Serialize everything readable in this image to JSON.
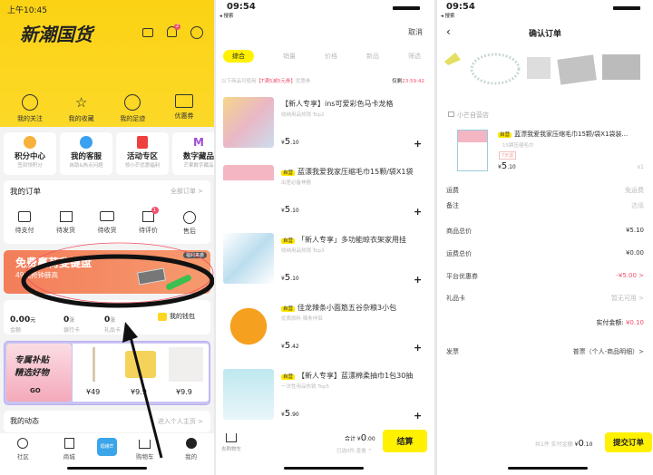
{
  "screen1": {
    "status_time": "上午10:45",
    "logo_text": "新潮国货",
    "notification_badge": "2",
    "quick_links": [
      {
        "label": "我的关注",
        "icon": "heart-icon"
      },
      {
        "label": "我的收藏",
        "icon": "star-icon"
      },
      {
        "label": "我的足迹",
        "icon": "clock-icon"
      },
      {
        "label": "优惠券",
        "icon": "ticket-icon"
      }
    ],
    "service_cards": [
      {
        "title": "积分中心",
        "sub": "签到领积分"
      },
      {
        "title": "我的客服",
        "sub": "自助&热点问题"
      },
      {
        "title": "活动专区",
        "sub": "领小芒优惠福利"
      },
      {
        "title": "数字藏品",
        "sub": "芒果数字藏品"
      }
    ],
    "orders": {
      "title": "我的订单",
      "all": "全部订单 >",
      "items": [
        {
          "label": "待支付"
        },
        {
          "label": "待发货"
        },
        {
          "label": "待收货"
        },
        {
          "label": "待评价",
          "badge": "1"
        },
        {
          "label": "售后"
        }
      ]
    },
    "banner": {
      "title": "免费赢荷斐键盘",
      "sub": "49元抢钟薛高",
      "corner": "福利来袭"
    },
    "wallet": {
      "amount": "0.00",
      "amount_unit": "元",
      "amount_label": "金额",
      "bank_count": "0",
      "bank_unit": "张",
      "bank_label": "银行卡",
      "gift_count": "0",
      "gift_unit": "张",
      "gift_label": "礼品卡",
      "wallet_label": "我的钱包"
    },
    "promo": {
      "title1": "专属补贴",
      "title2": "精选好物",
      "go": "GO",
      "prices": [
        "¥49",
        "¥9.9",
        "¥9.9"
      ]
    },
    "dynamics": {
      "title": "我的动态",
      "link": "进入个人主页 >"
    },
    "tabbar": [
      {
        "label": "社区"
      },
      {
        "label": "商城"
      },
      {
        "label": "逛綫芒"
      },
      {
        "label": "购物车"
      },
      {
        "label": "我的"
      }
    ]
  },
  "screen2": {
    "status_time": "09:54",
    "back_label": "◂ 搜索",
    "cancel": "取消",
    "filters": [
      "综合",
      "销量",
      "价格",
      "新品",
      "筛选"
    ],
    "coupon_prefix": "以下商品可使用",
    "coupon_name": "【T满5减5元券】",
    "coupon_suffix": "优惠券",
    "countdown_label": "仅剩",
    "countdown": "23:59:42",
    "products": [
      {
        "tag": "",
        "title": "【新人专享】ins可爱彩色马卡龙格",
        "sub": "收纳用品热销 Top2",
        "price_int": "5",
        "price_dec": ".10"
      },
      {
        "tag": "自营",
        "title": "蓝漂我爱我家压缩毛巾15颗/袋X1袋",
        "sub": "出差必备神器",
        "price_int": "5",
        "price_dec": ".10"
      },
      {
        "tag": "自营",
        "title": "「新人专享」多功能晾衣架家用挂",
        "sub": "收纳用品热销 Top3",
        "price_int": "5",
        "price_dec": ".10"
      },
      {
        "tag": "自营",
        "title": "佳龙辣条小面筋五谷杂粮3小包",
        "sub": "优质原料 辣条伴侣",
        "price_int": "5",
        "price_dec": ".42"
      },
      {
        "tag": "自营",
        "title": "【新人专享】蓝漂棉柔抽巾1包30抽",
        "sub": "一次性用品热销 Top5",
        "price_int": "5",
        "price_dec": ".90"
      }
    ],
    "cart_label": "去购物车",
    "total_label": "合计",
    "total_int": "0",
    "total_dec": ".00",
    "selected": "已选0件,查看 ^",
    "checkout": "结算"
  },
  "screen3": {
    "status_time": "09:54",
    "back_label": "◂ 搜索",
    "title": "确认订单",
    "store": "小芒自营店",
    "product": {
      "tag": "自营",
      "title": "蓝漂我爱我家压缩毛巾15颗/袋X1袋装...",
      "sub": "15颗压缩毛巾",
      "badge": "7天退",
      "price_int": "5",
      "price_dec": ".10",
      "qty": "x1"
    },
    "rows": [
      {
        "label": "运费",
        "value": "免运费"
      },
      {
        "label": "备注",
        "value": "选填"
      },
      {
        "label": "商品总价",
        "value": "¥5.10"
      },
      {
        "label": "运费总价",
        "value": "¥0.00"
      },
      {
        "label": "平台优惠券",
        "value": "-¥5.00 >"
      },
      {
        "label": "礼品卡",
        "value": "暂无可用 >"
      }
    ],
    "paid_label": "实付金额:",
    "paid_value": "¥0.10",
    "invoice_label": "发票",
    "invoice_value": "普票（个人-商品明细）>",
    "bottom_summary": "共1件 实付金额",
    "bottom_int": "0",
    "bottom_dec": ".10",
    "submit": "提交订单"
  },
  "colors": {
    "brand_yellow": "#fcd620",
    "accent_pink": "#f0506e",
    "button_yellow": "#fff100"
  }
}
